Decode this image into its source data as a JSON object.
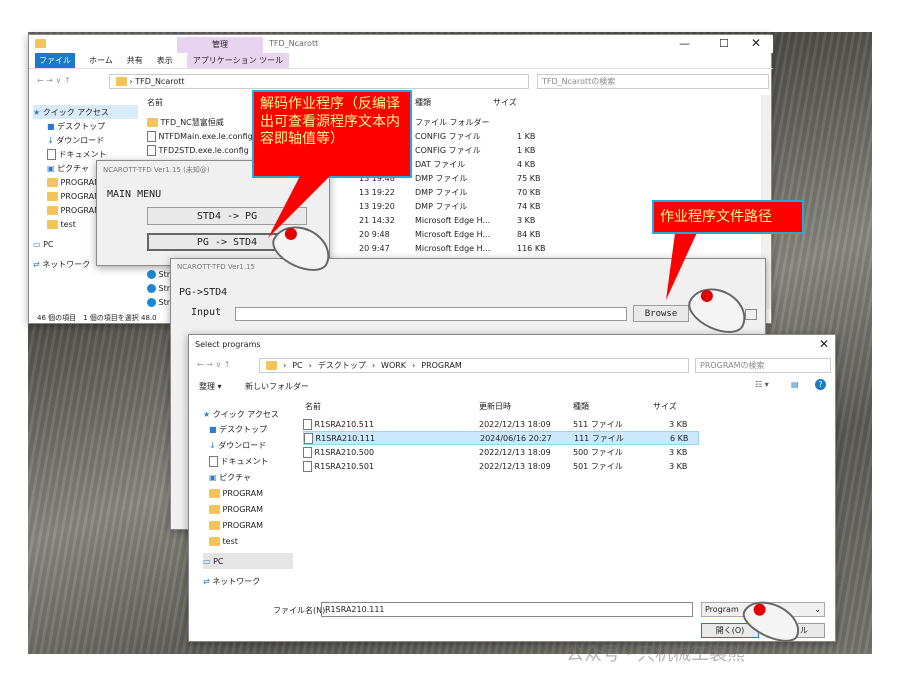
{
  "explorer": {
    "ribbon_tabs": [
      "ファイル",
      "ホーム",
      "共有",
      "表示",
      "アプリケーション ツール"
    ],
    "manage_tab": "管理",
    "title": "TFD_Ncarott",
    "address": "TFD_Ncarott",
    "search_placeholder": "TFD_Ncarottの検索",
    "nav": [
      "クイック アクセス",
      "デスクトップ",
      "ダウンロード",
      "ドキュメント",
      "ピクチャ",
      "PROGRAM",
      "PROGRAM",
      "PROGRAM",
      "test",
      "PC",
      "ネットワーク"
    ],
    "col_name": "名前",
    "col_type": "種類",
    "col_size": "サイズ",
    "files": [
      {
        "name": "TFD_NC慧富恒威",
        "time": "",
        "type": "ファイル フォルダー",
        "size": ""
      },
      {
        "name": "NTFDMain.exe.le.config",
        "time": "",
        "type": "CONFIG ファイル",
        "size": "1 KB"
      },
      {
        "name": "TFD2STD.exe.le.config",
        "time": "",
        "type": "CONFIG ファイル",
        "size": "1 KB"
      },
      {
        "name": "",
        "time": "",
        "type": "DAT ファイル",
        "size": "4 KB"
      },
      {
        "name": "",
        "time": "13 19:48",
        "type": "DMP ファイル",
        "size": "75 KB"
      },
      {
        "name": "",
        "time": "13 19:22",
        "type": "DMP ファイル",
        "size": "70 KB"
      },
      {
        "name": "",
        "time": "13 19:20",
        "type": "DMP ファイル",
        "size": "74 KB"
      },
      {
        "name": "",
        "time": "21 14:32",
        "type": "Microsoft Edge H...",
        "size": "3 KB"
      },
      {
        "name": "",
        "time": "20 9:48",
        "type": "Microsoft Edge H...",
        "size": "84 KB"
      },
      {
        "name": "",
        "time": "20 9:47",
        "type": "Microsoft Edge H...",
        "size": "116 KB"
      }
    ],
    "extra_files": [
      "Stru",
      "Stru",
      "Stru"
    ],
    "status": "46 個の項目　1 個の項目を選択  48.0"
  },
  "ncarott_main": {
    "title": "NCAROTT-TFD Ver1.15 (未知@)",
    "menu": "MAIN MENU",
    "btn1": "STD4 -> PG",
    "btn2": "PG -> STD4"
  },
  "ncarott_pg": {
    "title": "NCAROTT-TFD Ver1.15",
    "heading": "PG->STD4",
    "input_label": "Input",
    "browse": "Browse"
  },
  "dialog": {
    "title": "Select programs",
    "path": [
      "PC",
      "デスクトップ",
      "WORK",
      "PROGRAM"
    ],
    "search_placeholder": "PROGRAMの検索",
    "organize": "整理 ▾",
    "new_folder": "新しいフォルダー",
    "nav": [
      "クイック アクセス",
      "デスクトップ",
      "ダウンロード",
      "ドキュメント",
      "ピクチャ",
      "PROGRAM",
      "PROGRAM",
      "PROGRAM",
      "test",
      "PC",
      "ネットワーク"
    ],
    "col_name": "名前",
    "col_date": "更新日時",
    "col_type": "種類",
    "col_size": "サイズ",
    "files": [
      {
        "name": "R1SRA210.511",
        "date": "2022/12/13 18:09",
        "type": "511 ファイル",
        "size": "3 KB"
      },
      {
        "name": "R1SRA210.111",
        "date": "2024/06/16 20:27",
        "type": "111 ファイル",
        "size": "6 KB"
      },
      {
        "name": "R1SRA210.500",
        "date": "2022/12/13 18:09",
        "type": "500 ファイル",
        "size": "3 KB"
      },
      {
        "name": "R1SRA210.501",
        "date": "2022/12/13 18:09",
        "type": "501 ファイル",
        "size": "3 KB"
      }
    ],
    "filename_label": "ファイル名(N):",
    "filename_value": "R1SRA210.111",
    "filter": "Program",
    "open": "開く(O)",
    "cancel": "ンセル"
  },
  "callouts": {
    "decode": "解码作业程序（反编译出可查看源程序文本内容即轴值等）",
    "path": "作业程序文件路径"
  },
  "watermark": "公众号 · 只机械工装熊",
  "colors": {
    "callout_bg": "#ff0000",
    "callout_text": "#fffb8a",
    "selected_row": "#cce8ff"
  }
}
